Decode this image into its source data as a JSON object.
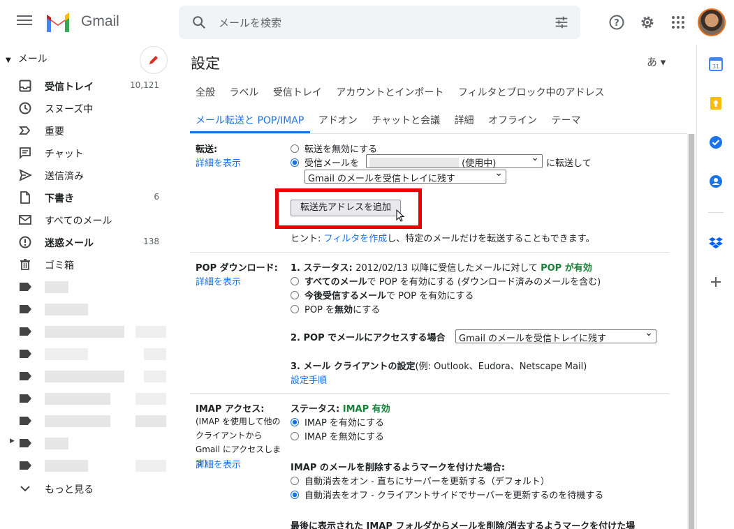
{
  "app": {
    "name": "Gmail"
  },
  "search": {
    "placeholder": "メールを検索"
  },
  "sidebar": {
    "section": "メール",
    "items": [
      {
        "label": "受信トレイ",
        "count": "10,121",
        "bold": true
      },
      {
        "label": "スヌーズ中",
        "count": ""
      },
      {
        "label": "重要",
        "count": ""
      },
      {
        "label": "チャット",
        "count": ""
      },
      {
        "label": "送信済み",
        "count": ""
      },
      {
        "label": "下書き",
        "count": "6",
        "bold": true
      },
      {
        "label": "すべてのメール",
        "count": ""
      },
      {
        "label": "迷惑メール",
        "count": "138",
        "bold": true
      },
      {
        "label": "ゴミ箱",
        "count": ""
      }
    ],
    "more": "もっと見る"
  },
  "settings": {
    "title": "設定",
    "lang": "あ ▾",
    "tabs_row1": [
      "全般",
      "ラベル",
      "受信トレイ",
      "アカウントとインポート",
      "フィルタとブロック中のアドレス"
    ],
    "tabs_row2": [
      "メール転送と POP/IMAP",
      "アドオン",
      "チャットと会議",
      "詳細",
      "オフライン",
      "テーマ"
    ],
    "forwarding": {
      "label": "転送:",
      "link": "詳細を表示",
      "opt_disable": "転送を無効にする",
      "opt_enable_prefix": "受信メールを",
      "address_select": "(使用中)",
      "opt_enable_suffix": "に転送して",
      "keep_select": "Gmail のメールを受信トレイに残す",
      "add_button": "転送先アドレスを追加",
      "hint_prefix": "ヒント: ",
      "hint_link": "フィルタを作成",
      "hint_suffix": "し、特定のメールだけを転送することもできます。"
    },
    "pop": {
      "label": "POP ダウンロード:",
      "link": "詳細を表示",
      "status_prefix": "1. ステータス: ",
      "status_text": "2012/02/13 以降に受信したメールに対して ",
      "status_value": "POP が有効",
      "opt1_bold": "すべてのメール",
      "opt1_rest": "で POP を有効にする (ダウンロード済みのメールを含む)",
      "opt2_bold": "今後受信するメール",
      "opt2_rest": "で POP を有効にする",
      "opt3_prefix": "POP を",
      "opt3_bold": "無効",
      "opt3_suffix": "にする",
      "access_label": "2. POP でメールにアクセスする場合",
      "access_select": "Gmail のメールを受信トレイに残す",
      "client_label": "3. メール クライアントの設定",
      "client_examples": "(例: Outlook、Eudora、Netscape Mail)",
      "setup_link": "設定手順"
    },
    "imap": {
      "label": "IMAP アクセス:",
      "note": "(IMAP を使用して他のクライアントから Gmail にアクセスします)",
      "link": "詳細を表示",
      "status_prefix": "ステータス: ",
      "status_value": "IMAP 有効",
      "opt_enable": "IMAP を有効にする",
      "opt_disable": "IMAP を無効にする",
      "delete_heading": "IMAP のメールを削除するようマークを付けた場合:",
      "delete_opt1": "自動消去をオン - 直ちにサーバーを更新する（デフォルト）",
      "delete_opt2": "自動消去をオフ - クライアントサイドでサーバーを更新するのを待機する",
      "last_heading": "最後に表示された IMAP フォルダからメールを削除/消去するようマークを付けた場"
    }
  },
  "colors": {
    "accent": "#1a73e8",
    "highlight": "#ee0000",
    "status_green": "#188038"
  }
}
